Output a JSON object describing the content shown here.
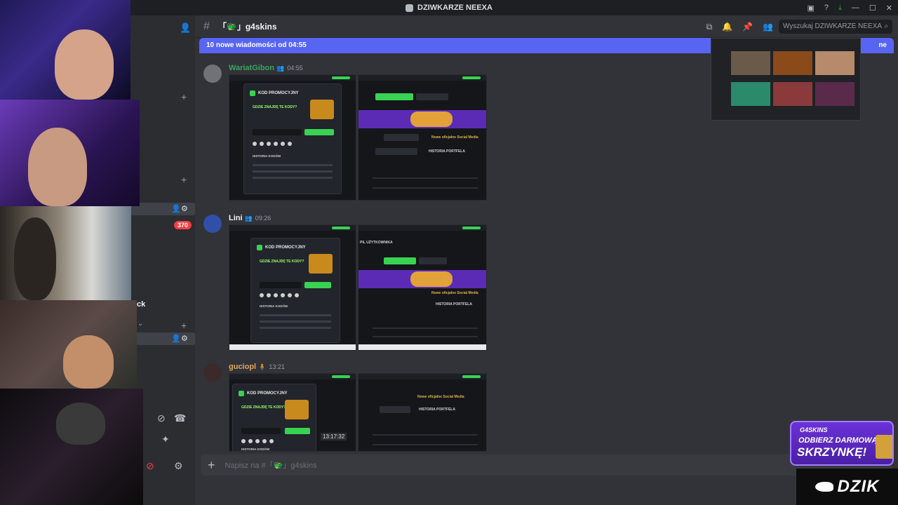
{
  "window": {
    "title": "DZIWKARZE NEEXA"
  },
  "channel": {
    "name": "「🐲」g4skins"
  },
  "search": {
    "placeholder": "Wyszukaj DZIWKARZE NEEXA"
  },
  "new_messages_bar": {
    "text": "10 nowe wiadomości od 04:55",
    "right_fragment": "ne"
  },
  "sidebar": {
    "mention_count": "370",
    "partial_label": "ick"
  },
  "messages": [
    {
      "author": "WariatGibon",
      "time": "04:55",
      "color": "#3ba55d"
    },
    {
      "author": "Lini",
      "time": "09:26",
      "color": "#f2f3f5"
    },
    {
      "author": "guciopl",
      "time": "13:21",
      "color": "#e0a75a"
    }
  ],
  "embed_text": {
    "promo_title": "KOD PROMOCYJNY",
    "promo_question": "GDZIE ZNAJDĘ TE KODY?",
    "promo_history": "HISTORIA KODÓW",
    "news_label": "Nowe oficjalne Social Media",
    "portfolio": "HISTORIA PORTFELA",
    "profile": "PIL UŻYTKOWNIKA",
    "clock": "13:17:32"
  },
  "composer": {
    "placeholder": "Napisz na #「🐲」g4skins"
  },
  "overlay": {
    "brand": "G4SKINS",
    "line1": "ODBIERZ DARMOWĄ",
    "line2": "SKRZYNKĘ!",
    "logo": "DZIK"
  },
  "colors": {
    "accent": "#5865f2",
    "background": "#313338",
    "sidebar": "#2b2d31",
    "mention": "#f23f43",
    "highlight": "#39d353"
  },
  "icons": [
    "search-icon",
    "bell-icon",
    "pin-icon",
    "members-icon",
    "threads-icon",
    "help-icon",
    "download-icon",
    "plus-icon",
    "gear-icon",
    "add-member-icon"
  ]
}
